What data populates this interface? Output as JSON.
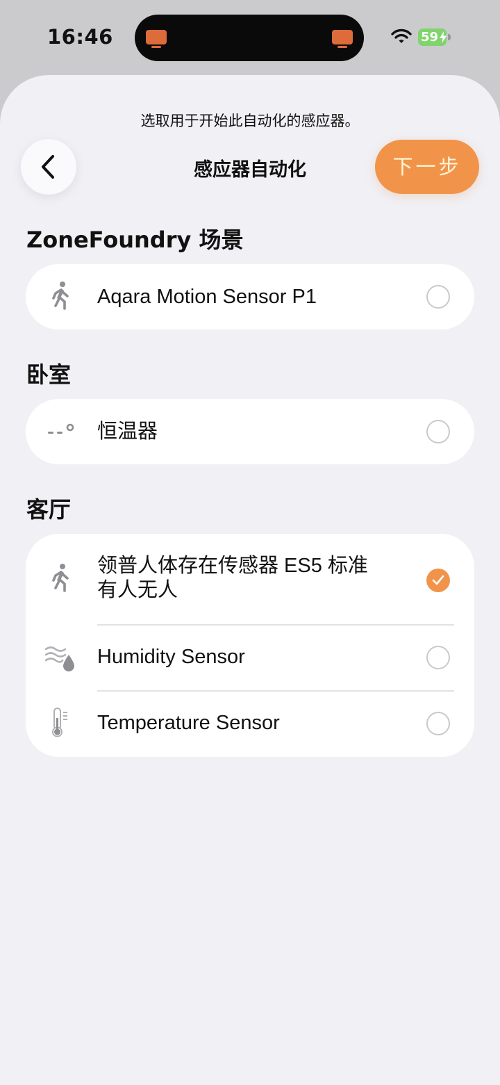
{
  "status_bar": {
    "time": "16:46",
    "battery_percent": "59",
    "accent_color": "#de6b3a"
  },
  "sheet": {
    "subtitle": "选取用于开始此自动化的感应器。",
    "title": "感应器自动化",
    "next_label": "下一步",
    "accent_color": "#f1944a"
  },
  "sections": [
    {
      "title": "ZoneFoundry 场景",
      "items": [
        {
          "label": "Aqara Motion Sensor P1",
          "icon": "motion-icon",
          "selected": false
        }
      ]
    },
    {
      "title": "卧室",
      "items": [
        {
          "label": "恒温器",
          "icon": "thermostat-icon",
          "selected": false
        }
      ]
    },
    {
      "title": "客厅",
      "items": [
        {
          "label": "领普人体存在传感器 ES5  标准\n有人无人",
          "icon": "motion-icon",
          "selected": true
        },
        {
          "label": "Humidity Sensor",
          "icon": "humidity-icon",
          "selected": false
        },
        {
          "label": "Temperature Sensor",
          "icon": "thermometer-icon",
          "selected": false
        }
      ]
    }
  ]
}
